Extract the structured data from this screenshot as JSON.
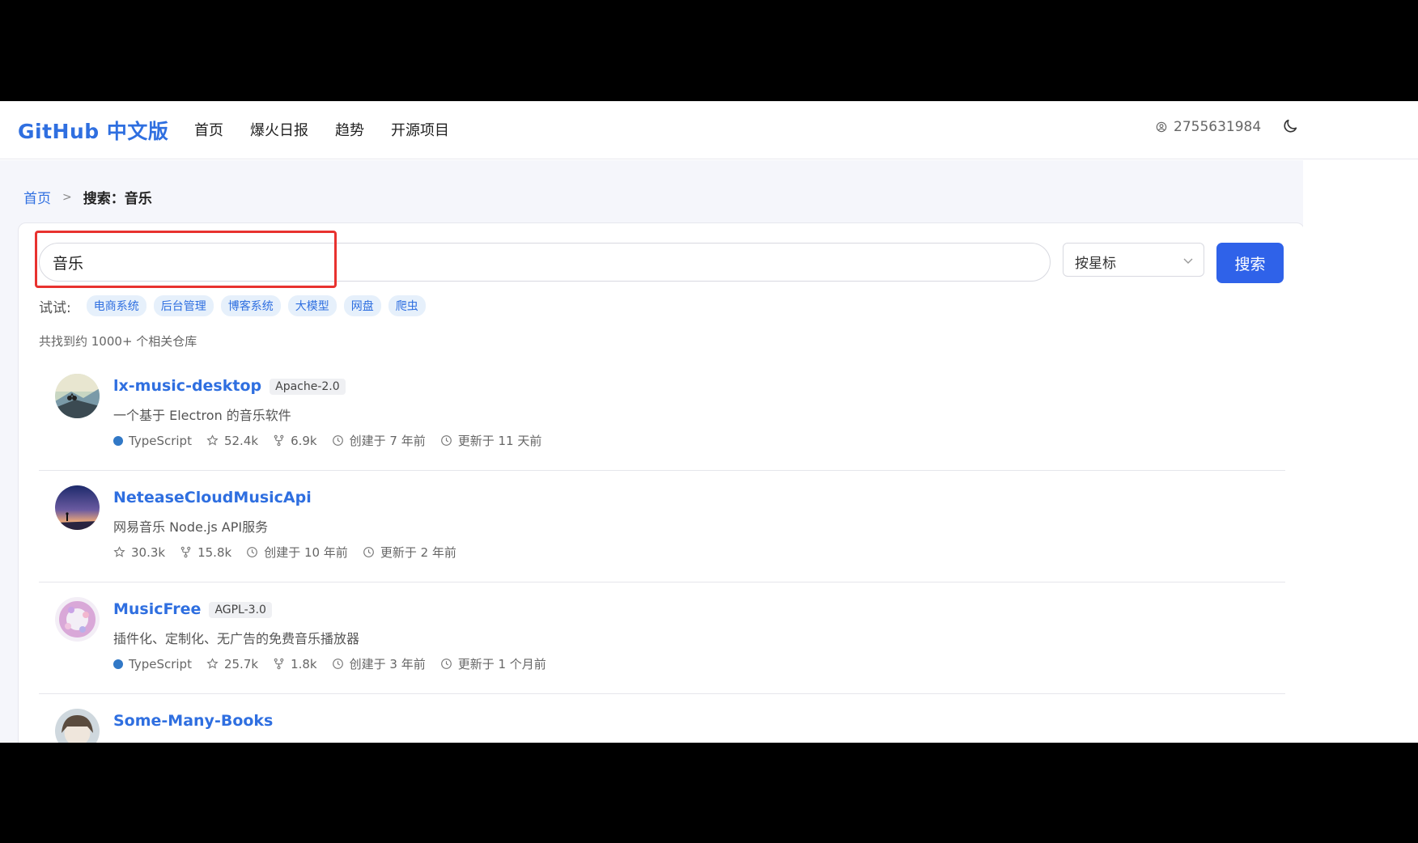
{
  "header": {
    "logo": "GitHub 中文版",
    "nav": [
      "首页",
      "爆火日报",
      "趋势",
      "开源项目"
    ],
    "user_id": "2755631984"
  },
  "breadcrumb": {
    "home": "首页",
    "separator": ">",
    "current": "搜索：音乐"
  },
  "search": {
    "value": "音乐",
    "sort_label": "按星标",
    "button_label": "搜索",
    "try_label": "试试:",
    "tags": [
      "电商系统",
      "后台管理",
      "博客系统",
      "大模型",
      "网盘",
      "爬虫"
    ],
    "result_count": "共找到约 1000+ 个相关仓库"
  },
  "colors": {
    "accent": "#2f6fe0",
    "button": "#2f62e9",
    "highlight": "#e8322f",
    "typescript": "#3178c6"
  },
  "repos": [
    {
      "name": "lx-music-desktop",
      "license": "Apache-2.0",
      "description": "一个基于 Electron 的音乐软件",
      "language": "TypeScript",
      "stars": "52.4k",
      "forks": "6.9k",
      "created": "创建于 7 年前",
      "updated": "更新于 11 天前"
    },
    {
      "name": "NeteaseCloudMusicApi",
      "license": "",
      "description": "网易音乐 Node.js API服务",
      "language": "",
      "stars": "30.3k",
      "forks": "15.8k",
      "created": "创建于 10 年前",
      "updated": "更新于 2 年前"
    },
    {
      "name": "MusicFree",
      "license": "AGPL-3.0",
      "description": "插件化、定制化、无广告的免费音乐播放器",
      "language": "TypeScript",
      "stars": "25.7k",
      "forks": "1.8k",
      "created": "创建于 3 年前",
      "updated": "更新于 1 个月前"
    },
    {
      "name": "Some-Many-Books",
      "license": "",
      "description": "",
      "language": "",
      "stars": "",
      "forks": "",
      "created": "",
      "updated": ""
    }
  ]
}
